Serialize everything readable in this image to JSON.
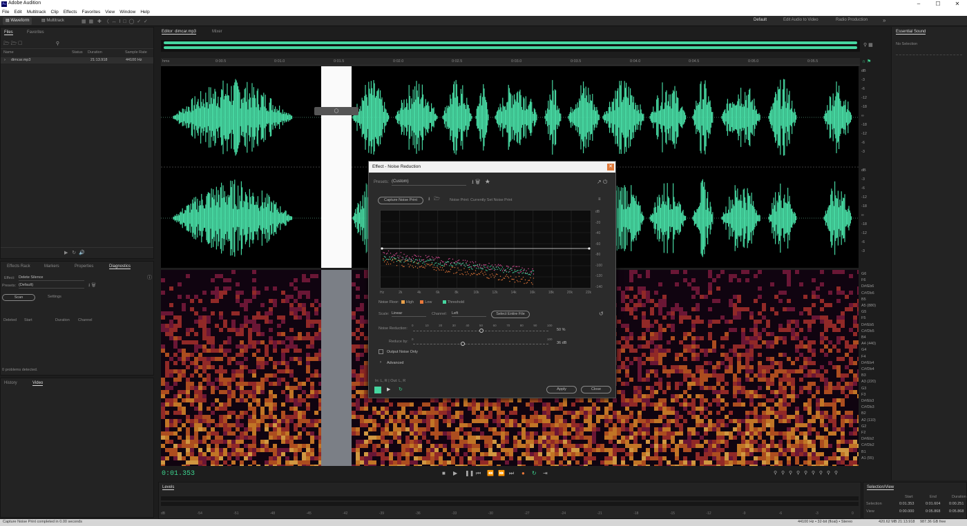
{
  "app": {
    "title": "Adobe Audition",
    "logo": "Au"
  },
  "menu": [
    "File",
    "Edit",
    "Multitrack",
    "Clip",
    "Effects",
    "Favorites",
    "View",
    "Window",
    "Help"
  ],
  "toolbar": {
    "waveform": "Waveform",
    "multitrack": "Multitrack",
    "workspaces": [
      "Default",
      "Edit Audio to Video",
      "Radio Production"
    ]
  },
  "files": {
    "tabs": [
      "Files",
      "Favorites"
    ],
    "columns": [
      "Name",
      "Status",
      "Duration",
      "Sample Rate"
    ],
    "rows": [
      {
        "name": "dimcar.mp3",
        "duration": "21:13.918",
        "rate": "44100 Hz"
      }
    ]
  },
  "lowpanel": {
    "tabs": [
      "Effects Rack",
      "Markers",
      "Properties",
      "Diagnostics"
    ],
    "effect_label": "Effect:",
    "effect": "Delete Silence",
    "presets_label": "Presets:",
    "preset": "(Default)",
    "scan": "Scan",
    "settings": "Settings",
    "columns": [
      "Deleted",
      "Start",
      "Duration",
      "Channel"
    ],
    "status": "0 problems detected."
  },
  "history": {
    "tabs": [
      "History",
      "Video"
    ]
  },
  "editor": {
    "tab": "Editor: dimcar.mp3",
    "tab2": "Mixer",
    "ruler_unit": "hms",
    "ticks": [
      "0:00.5",
      "0:01.0",
      "0:01.5",
      "0:02.0",
      "0:02.5",
      "0:03.0",
      "0:03.5",
      "0:04.0",
      "0:04.5",
      "0:05.0",
      "0:05.5"
    ],
    "db_top": [
      "dB",
      "-3",
      "-6",
      "-12",
      "-18",
      "∞",
      "-18",
      "-12",
      "-6",
      "-3"
    ],
    "db_bottom": [
      "dB",
      "-3",
      "-6",
      "-12",
      "-18",
      "∞",
      "-18",
      "-12",
      "-6",
      "-3"
    ],
    "notes": [
      "G6",
      "F6",
      "D#/Eb6",
      "C#/Db6",
      "B5",
      "A5 (880)",
      "G5",
      "F5",
      "D#/Eb5",
      "C#/Db5",
      "B4",
      "A4 (440)",
      "G4",
      "F4",
      "D#/Eb4",
      "C#/Db4",
      "B3",
      "A3 (220)",
      "G3",
      "F3",
      "D#/Eb3",
      "C#/Db3",
      "B2",
      "A2 (110)",
      "G2",
      "F2",
      "D#/Eb2",
      "C#/Db2",
      "B1",
      "A1 (55)"
    ]
  },
  "transport": {
    "time": "0:01.353"
  },
  "levels": {
    "title": "Levels",
    "scale": [
      "dB",
      "-54",
      "-51",
      "-48",
      "-45",
      "-42",
      "-39",
      "-36",
      "-33",
      "-30",
      "-27",
      "-24",
      "-21",
      "-18",
      "-15",
      "-12",
      "-9",
      "-6",
      "-3",
      "0"
    ]
  },
  "essential": {
    "title": "Essential Sound",
    "sub": "No Selection"
  },
  "selview": {
    "title": "Selection/View",
    "cols": [
      "Start",
      "End",
      "Duration"
    ],
    "rows": [
      {
        "label": "Selection",
        "start": "0:01.353",
        "end": "0:01.604",
        "dur": "0:00.251"
      },
      {
        "label": "View",
        "start": "0:00.000",
        "end": "0:05.868",
        "dur": "0:05.868"
      }
    ]
  },
  "status": {
    "left": "Capture Noise Print completed in 0.00 seconds",
    "right": [
      "44100 Hz • 32-bit (float) • Stereo",
      "420.62 MB",
      "21:13.918",
      "987.36 GB free"
    ]
  },
  "dialog": {
    "title": "Effect - Noise Reduction",
    "presets_label": "Presets:",
    "preset": "(Custom)",
    "capture": "Capture Noise Print",
    "noise_print": "Noise Print: Currently Set Noise Print",
    "ylabels": [
      "dB",
      "-20",
      "-40",
      "-60",
      "-80",
      "-100",
      "-120",
      "-140"
    ],
    "xlabels": [
      "Hz",
      "2k",
      "4k",
      "6k",
      "8k",
      "10k",
      "12k",
      "14k",
      "16k",
      "18k",
      "20k",
      "22k"
    ],
    "legend": [
      {
        "label": "Noise Floor:",
        "color": ""
      },
      {
        "label": "High",
        "color": "#e8a04a"
      },
      {
        "label": "Low",
        "color": "#e8783a"
      },
      {
        "label": "Threshold",
        "color": "#46d6a0"
      }
    ],
    "scale_label": "Scale:",
    "scale": "Linear",
    "channel_label": "Channel:",
    "channel": "Left",
    "select_entire": "Select Entire File",
    "nr_label": "Noise Reduction:",
    "nr_ticks": [
      "0",
      "10",
      "20",
      "30",
      "40",
      "50",
      "60",
      "70",
      "80",
      "90",
      "100"
    ],
    "nr_value": "50",
    "nr_unit": "%",
    "reduce_label": "Reduce by:",
    "reduce_ticks": [
      "0",
      "",
      "",
      "",
      "",
      "",
      "",
      "",
      "",
      "",
      "100"
    ],
    "reduce_value": "36",
    "reduce_unit": "dB",
    "output_only": "Output Noise Only",
    "advanced": "Advanced",
    "io": "In: L, R | Out: L, R",
    "apply": "Apply",
    "close": "Close"
  },
  "colors": {
    "accent": "#46d6a0",
    "timecode": "#3cd28e"
  }
}
